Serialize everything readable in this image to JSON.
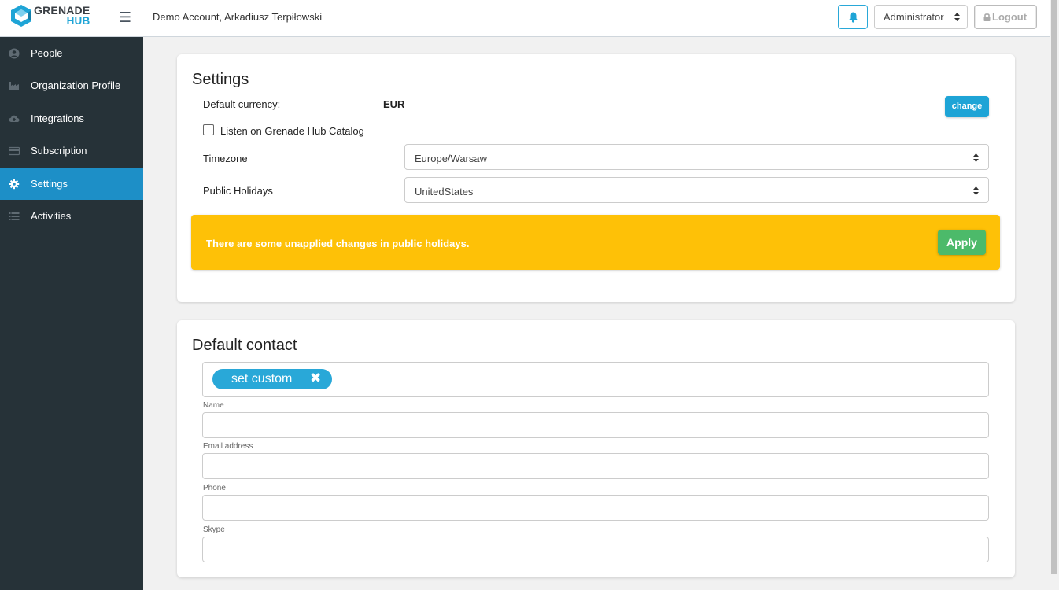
{
  "header": {
    "logo_line1": "GRENADE",
    "logo_line2": "HUB",
    "account_name": "Demo Account, Arkadiusz Terpiłowski",
    "role": "Administrator",
    "logout_label": "Logout"
  },
  "sidebar": {
    "items": [
      {
        "label": "People",
        "icon": "user-circle-icon"
      },
      {
        "label": "Organization Profile",
        "icon": "factory-icon"
      },
      {
        "label": "Integrations",
        "icon": "cloud-upload-icon"
      },
      {
        "label": "Subscription",
        "icon": "credit-card-icon"
      },
      {
        "label": "Settings",
        "icon": "gear-icon",
        "active": true
      },
      {
        "label": "Activities",
        "icon": "list-icon"
      }
    ]
  },
  "settings": {
    "title": "Settings",
    "currency_label": "Default currency:",
    "currency_value": "EUR",
    "change_label": "change",
    "listen_label": "Listen on Grenade Hub Catalog",
    "listen_checked": false,
    "timezone_label": "Timezone",
    "timezone_value": "Europe/Warsaw",
    "holidays_label": "Public Holidays",
    "holidays_value": "UnitedStates",
    "warning_text": "There are some unapplied changes in public holidays.",
    "apply_label": "Apply"
  },
  "contact": {
    "title": "Default contact",
    "tag_label": "set custom",
    "tag_close": "✖",
    "name_label": "Name",
    "email_label": "Email address",
    "phone_label": "Phone",
    "skype_label": "Skype"
  },
  "colors": {
    "accent": "#1ea4d6",
    "sidebar_bg": "#263238",
    "sidebar_active": "#1d8fc7",
    "warning": "#fec107",
    "apply": "#4cba6a"
  }
}
